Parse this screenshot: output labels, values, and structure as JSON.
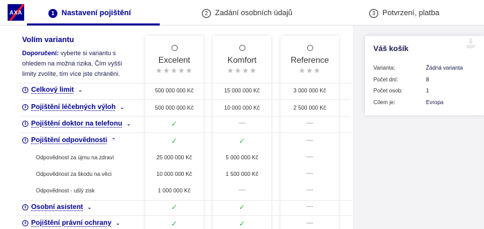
{
  "header": {
    "logo_text": "AXA",
    "steps": [
      {
        "num": "1",
        "label": "Nastavení pojištění"
      },
      {
        "num": "2",
        "label": "Zadání osobních údajů"
      },
      {
        "num": "3",
        "label": "Potvrzení, platba"
      }
    ]
  },
  "left": {
    "title": "Volím variantu",
    "recommend_lead": "Doporučení:",
    "recommend_text": " vyberte si variantu s ohledem na možná rizika. Čím vyšší limity zvolíte, tím více jste chráněni."
  },
  "variants": [
    {
      "name": "Excelent",
      "stars": "★★★★★"
    },
    {
      "name": "Komfort",
      "stars": "★★★★"
    },
    {
      "name": "Reference",
      "stars": "★★★"
    }
  ],
  "rows": [
    {
      "label": "Celkový limit",
      "values": [
        "500 000 000 Kč",
        "15 000 000 Kč",
        "3 000 000 Kč"
      ]
    },
    {
      "label": "Pojištění léčebných výloh",
      "values": [
        "500 000 000 Kč",
        "10 000 000 Kč",
        "2 500 000 Kč"
      ]
    },
    {
      "label": "Pojištění doktor na telefonu",
      "values": [
        "✓",
        "—",
        "—"
      ]
    },
    {
      "label": "Pojištění odpovědnosti",
      "values": [
        "✓",
        "✓",
        "—"
      ]
    },
    {
      "label": "Osobní asistent",
      "values": [
        "✓",
        "✓",
        "—"
      ]
    },
    {
      "label": "Pojištění právní ochrany",
      "values": [
        "✓",
        "✓",
        "—"
      ]
    }
  ],
  "subrows": [
    {
      "label": "Odpovědnost za újmu na zdraví",
      "values": [
        "25 000 000 Kč",
        "5 000 000 Kč",
        "—"
      ]
    },
    {
      "label": "Odpovědnost za škodu na věci",
      "values": [
        "10 000 000 Kč",
        "1 500 000 Kč",
        "—"
      ]
    },
    {
      "label": "Odpovědnost - ušlý zisk",
      "values": [
        "1 000 000 Kč",
        "—",
        "—"
      ]
    }
  ],
  "cart": {
    "title": "Váš košík",
    "pdf_label": "PDF",
    "items": [
      {
        "label": "Varianta:",
        "value": "Žádná varianta"
      },
      {
        "label": "Počet dní:",
        "value": "8"
      },
      {
        "label": "Počet osob:",
        "value": "1"
      },
      {
        "label": "Cílem je:",
        "value": "Evropa"
      }
    ]
  },
  "colors": {
    "brand": "#00008f",
    "check": "#39b54a",
    "logo_stripe": "#ff1721"
  }
}
